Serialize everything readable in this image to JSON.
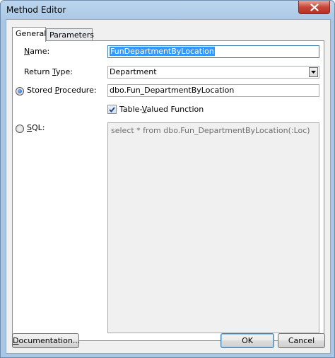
{
  "window": {
    "title": "Method Editor"
  },
  "tabs": [
    {
      "label": "General",
      "active": true
    },
    {
      "label": "Parameters",
      "active": false
    }
  ],
  "form": {
    "name_label_mnemonic": "N",
    "name_label_rest": "ame:",
    "name_value": "FunDepartmentByLocation",
    "return_type_label_pre": "Return ",
    "return_type_label_mnemonic": "T",
    "return_type_label_rest": "ype:",
    "return_type_value": "Department",
    "stored_procedure_label_pre": "Stored ",
    "stored_procedure_label_mnemonic": "P",
    "stored_procedure_label_rest": "rocedure:",
    "stored_procedure_value": "dbo.Fun_DepartmentByLocation",
    "stored_procedure_selected": true,
    "table_valued_label_pre": "Table-",
    "table_valued_label_mnemonic": "V",
    "table_valued_label_rest": "alued Function",
    "table_valued_checked": true,
    "sql_label_pre": "S",
    "sql_label_mnemonic": "Q",
    "sql_label_rest": "L:",
    "sql_selected": false,
    "sql_text": "select * from dbo.Fun_DepartmentByLocation(:Loc)"
  },
  "buttons": {
    "documentation_mnemonic": "D",
    "documentation_rest": "ocumentation...",
    "ok": "OK",
    "cancel": "Cancel"
  },
  "colors": {
    "selection": "#3399ff",
    "panel": "#ffffff",
    "dialog": "#f0f0f0"
  }
}
